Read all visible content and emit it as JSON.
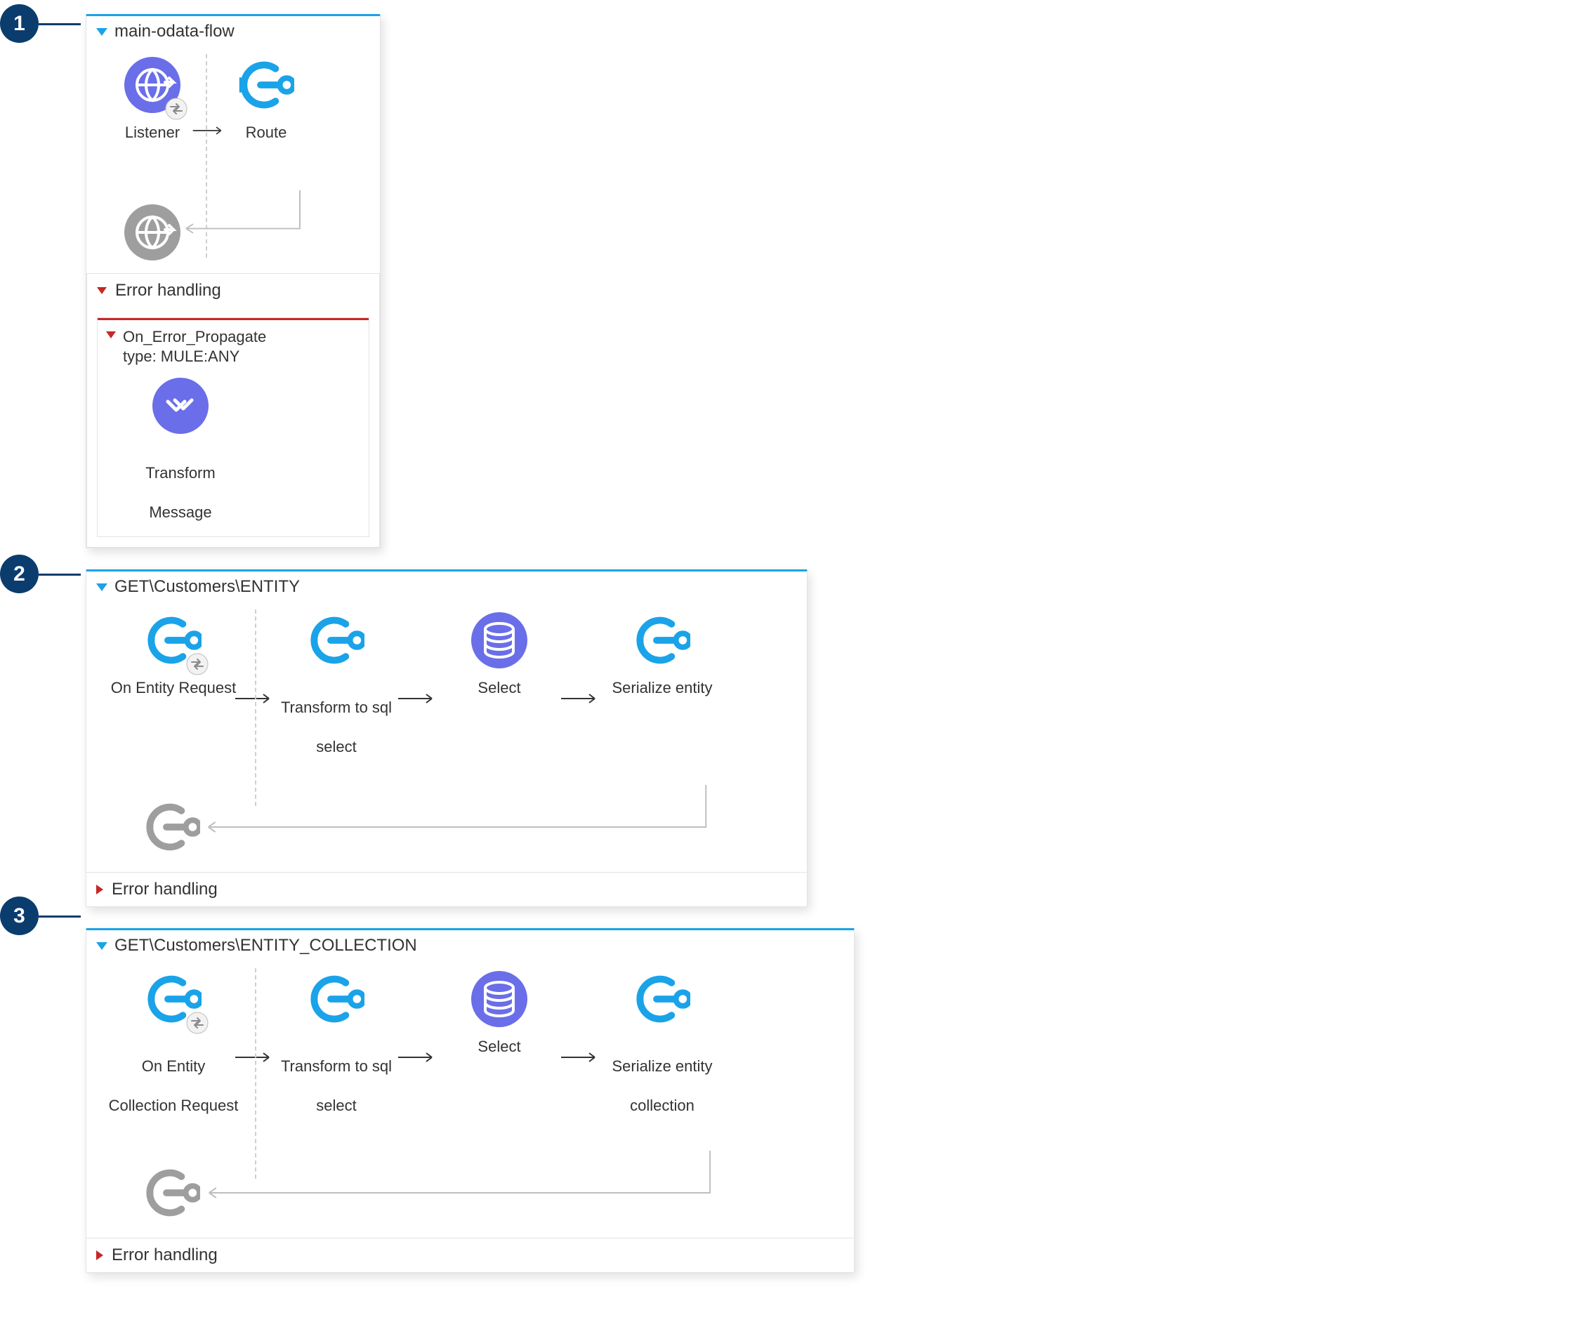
{
  "callouts": {
    "c1": "1",
    "c2": "2",
    "c3": "3"
  },
  "flows": {
    "f1": {
      "title": "main-odata-flow",
      "listener": "Listener",
      "route": "Route",
      "error_handling": "Error handling",
      "on_error_l1": "On_Error_Propagate",
      "on_error_l2": "type: MULE:ANY",
      "transform_msg_l1": "Transform",
      "transform_msg_l2": "Message"
    },
    "f2": {
      "title": "GET\\Customers\\ENTITY",
      "n1": "On Entity Request",
      "n2_l1": "Transform to sql",
      "n2_l2": "select",
      "n3": "Select",
      "n4": "Serialize entity",
      "error_handling": "Error handling"
    },
    "f3": {
      "title": "GET\\Customers\\ENTITY_COLLECTION",
      "n1_l1": "On Entity",
      "n1_l2": "Collection Request",
      "n2_l1": "Transform to sql",
      "n2_l2": "select",
      "n3": "Select",
      "n4_l1": "Serialize entity",
      "n4_l2": "collection",
      "error_handling": "Error handling"
    }
  }
}
